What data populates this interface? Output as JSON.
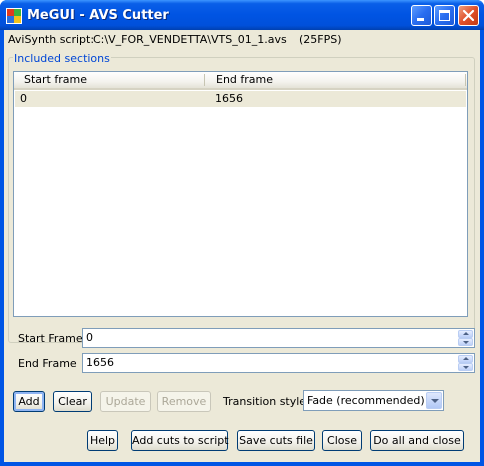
{
  "window": {
    "title": "MeGUI - AVS Cutter"
  },
  "script_info": {
    "label": "AviSynth script:",
    "path": "C:\\V_FOR_VENDETTA\\VTS_01_1.avs",
    "fps": "(25FPS)"
  },
  "sections": {
    "group_title": "Included sections",
    "columns": [
      "Start frame",
      "End frame"
    ],
    "rows": [
      {
        "start": "0",
        "end": "1656"
      }
    ]
  },
  "start_frame": {
    "label": "Start Frame",
    "value": "0"
  },
  "end_frame": {
    "label": "End Frame",
    "value": "1656"
  },
  "buttons": {
    "add": "Add",
    "clear": "Clear",
    "update": "Update",
    "remove": "Remove",
    "help": "Help",
    "add_cuts": "Add cuts to script",
    "save_cuts": "Save cuts file",
    "close": "Close",
    "do_all": "Do all and close"
  },
  "transition": {
    "label": "Transition style",
    "value": "Fade (recommended)"
  },
  "icons": {
    "app": "megui-app-icon",
    "minimize": "minimize-icon",
    "maximize": "maximize-icon",
    "close": "close-icon"
  }
}
